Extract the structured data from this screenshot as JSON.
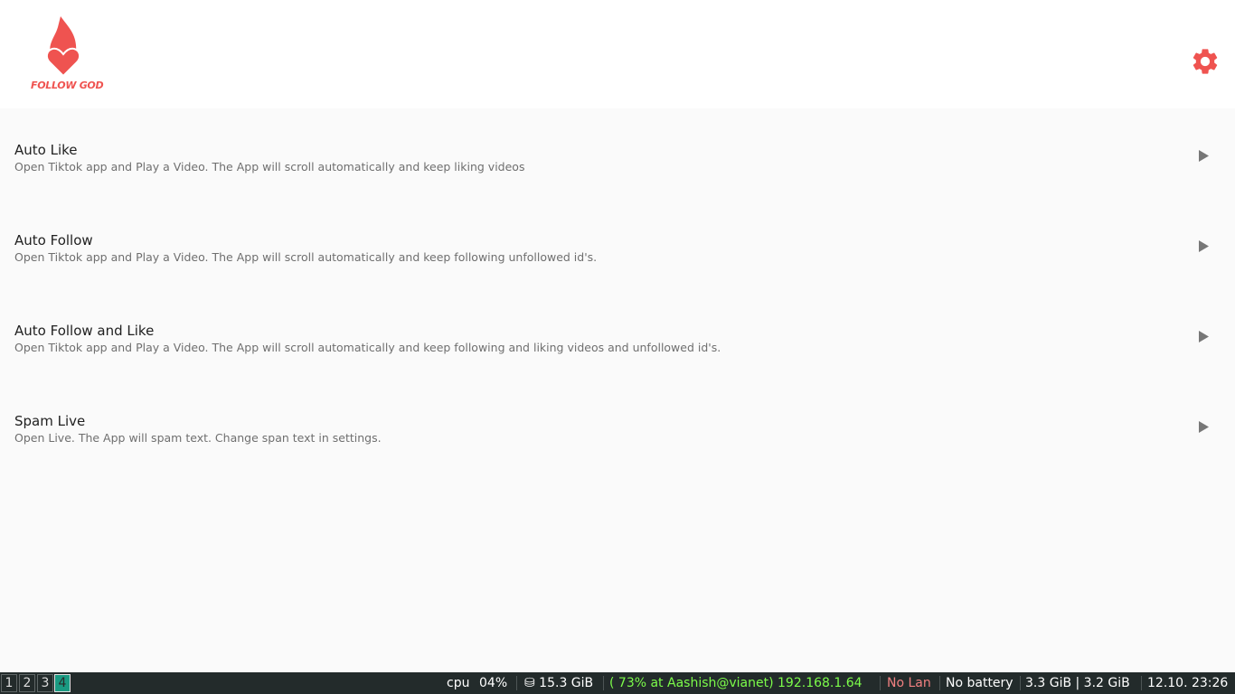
{
  "app": {
    "logo_text": "FOLLOW GOD",
    "brand_color": "#ef5350",
    "settings_icon": "gear-icon"
  },
  "items": [
    {
      "title": "Auto Like",
      "description": "Open Tiktok app and Play a Video. The App will scroll automatically and keep liking videos"
    },
    {
      "title": "Auto Follow",
      "description": "Open Tiktok app and Play a Video. The App will scroll automatically and keep following unfollowed id's."
    },
    {
      "title": "Auto Follow and Like",
      "description": "Open Tiktok app and Play a Video. The App will scroll automatically and keep following and liking videos and unfollowed id's."
    },
    {
      "title": "Spam Live",
      "description": "Open Live. The App will spam text. Change span text in settings."
    }
  ],
  "taskbar": {
    "workspaces": [
      "1",
      "2",
      "3",
      "4"
    ],
    "active_workspace": "4",
    "cpu_label": "cpu",
    "cpu_value": "04%",
    "disk": "⛁ 15.3 GiB",
    "wifi": "( 73% at Aashish@vianet) 192.168.1.64",
    "lan": "No Lan",
    "battery": "No battery",
    "memory": "3.3 GiB | 3.2 GiB",
    "datetime": "12.10. 23:26",
    "colors": {
      "background": "#232b2b",
      "active_workspace": "#1a9a82",
      "wifi": "#7cfc4a",
      "lan": "#f08080"
    }
  }
}
